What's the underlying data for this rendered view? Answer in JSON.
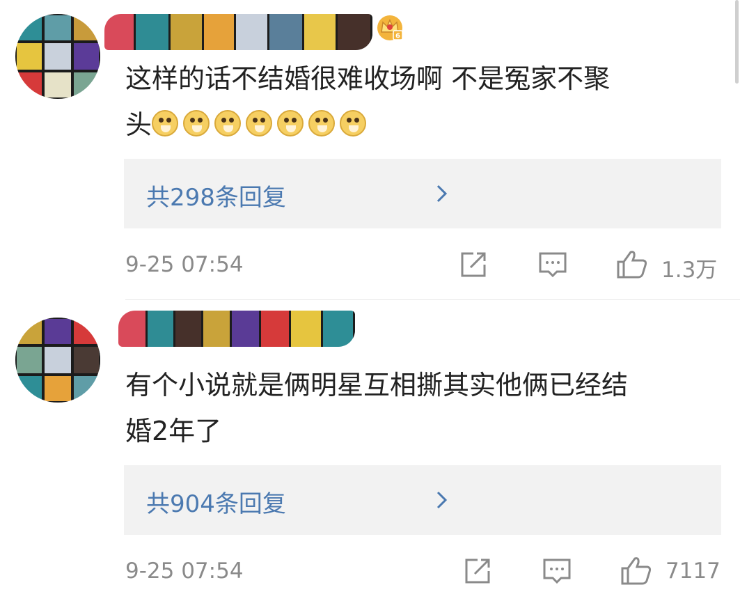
{
  "comments": [
    {
      "text_line1": "这样的话不结婚很难收场啊 不是冤家不聚",
      "text_line2": "头",
      "emoji_names": [
        "doge-emoji",
        "doge-emoji",
        "doge-emoji",
        "doge-emoji",
        "doge-emoji",
        "doge-emoji",
        "doge-emoji"
      ],
      "replies_label": "共298条回复",
      "timestamp": "9-25 07:54",
      "likes": "1.3万",
      "badge": "crown-level-badge",
      "badge_level": "6"
    },
    {
      "text_line1": "有个小说就是俩明星互相撕其实他俩已经结",
      "text_line2": "婚2年了",
      "replies_label": "共904条回复",
      "timestamp": "9-25 07:54",
      "likes": "7117"
    }
  ],
  "icons": {
    "share": "share-icon",
    "comment": "comment-icon",
    "like": "thumbs-up-icon",
    "reply_chevron": "chevron-right-icon"
  },
  "colors": {
    "reply_link": "#4b79b0",
    "meta_text": "#8a8a8a",
    "reply_box": "#f2f2f2",
    "body_text": "#222222",
    "crown_badge": "#f3b43c"
  }
}
